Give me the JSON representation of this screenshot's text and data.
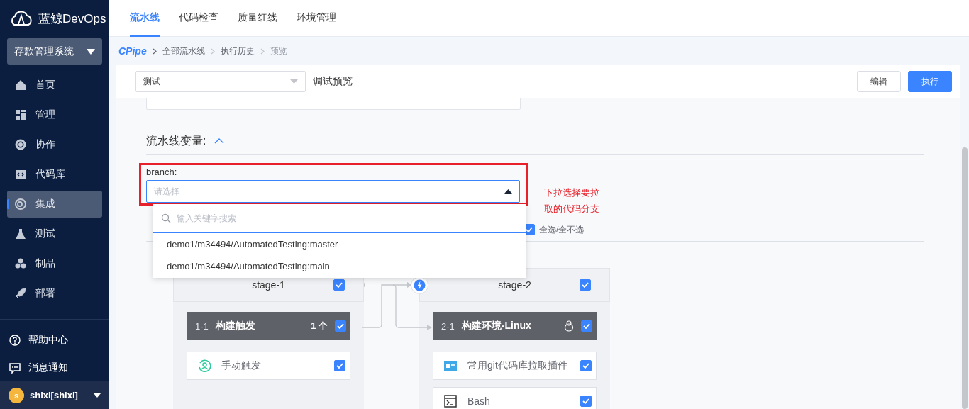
{
  "brand": {
    "name": "蓝鲸DevOps"
  },
  "project_selector": {
    "value": "存款管理系统"
  },
  "sidebar": {
    "items": [
      {
        "label": "首页",
        "selected": false
      },
      {
        "label": "管理",
        "selected": false
      },
      {
        "label": "协作",
        "selected": false
      },
      {
        "label": "代码库",
        "selected": false
      },
      {
        "label": "集成",
        "selected": true
      },
      {
        "label": "测试",
        "selected": false
      },
      {
        "label": "制品",
        "selected": false
      },
      {
        "label": "部署",
        "selected": false
      }
    ],
    "footer": [
      {
        "label": "帮助中心"
      },
      {
        "label": "消息通知"
      }
    ]
  },
  "user": {
    "avatar_letter": "s",
    "name": "shixi[shixi]"
  },
  "top_tabs": [
    {
      "label": "流水线",
      "selected": true
    },
    {
      "label": "代码检查",
      "selected": false
    },
    {
      "label": "质量红线",
      "selected": false
    },
    {
      "label": "环境管理",
      "selected": false
    }
  ],
  "breadcrumb": {
    "logo": "CPipe",
    "items": [
      "全部流水线",
      "执行历史",
      "预览"
    ]
  },
  "toolbar": {
    "pipeline_select": {
      "value": "测试"
    },
    "mode_label": "调试预览",
    "buttons": [
      {
        "label": "编辑",
        "kind": "default"
      },
      {
        "label": "执行",
        "kind": "primary"
      }
    ]
  },
  "variables": {
    "title": "流水线变量:",
    "expanded": true,
    "fields": [
      {
        "label": "branch:",
        "placeholder": "请选择",
        "open": true
      }
    ]
  },
  "annotation": {
    "text": "下拉选择要拉取的代码分支"
  },
  "dropdown": {
    "search_placeholder": "输入关键字搜索",
    "options": [
      "demo1/m34494/AutomatedTesting:master",
      "demo1/m34494/AutomatedTesting:main"
    ]
  },
  "select_all": {
    "label": "全选/全不选",
    "checked": true
  },
  "stages": [
    {
      "name": "stage-1",
      "checked": true,
      "jobs": [
        {
          "index": "1-1",
          "name": "构建触发",
          "count": "1 个",
          "checked": true,
          "elements": [
            {
              "name": "手动触发",
              "checked": true
            }
          ]
        }
      ]
    },
    {
      "name": "stage-2",
      "checked": true,
      "jobs": [
        {
          "index": "2-1",
          "name": "构建环境-Linux",
          "checked": true,
          "elements": [
            {
              "name": "常用git代码库拉取插件",
              "checked": true
            },
            {
              "name": "Bash",
              "checked": true
            }
          ]
        }
      ]
    }
  ]
}
